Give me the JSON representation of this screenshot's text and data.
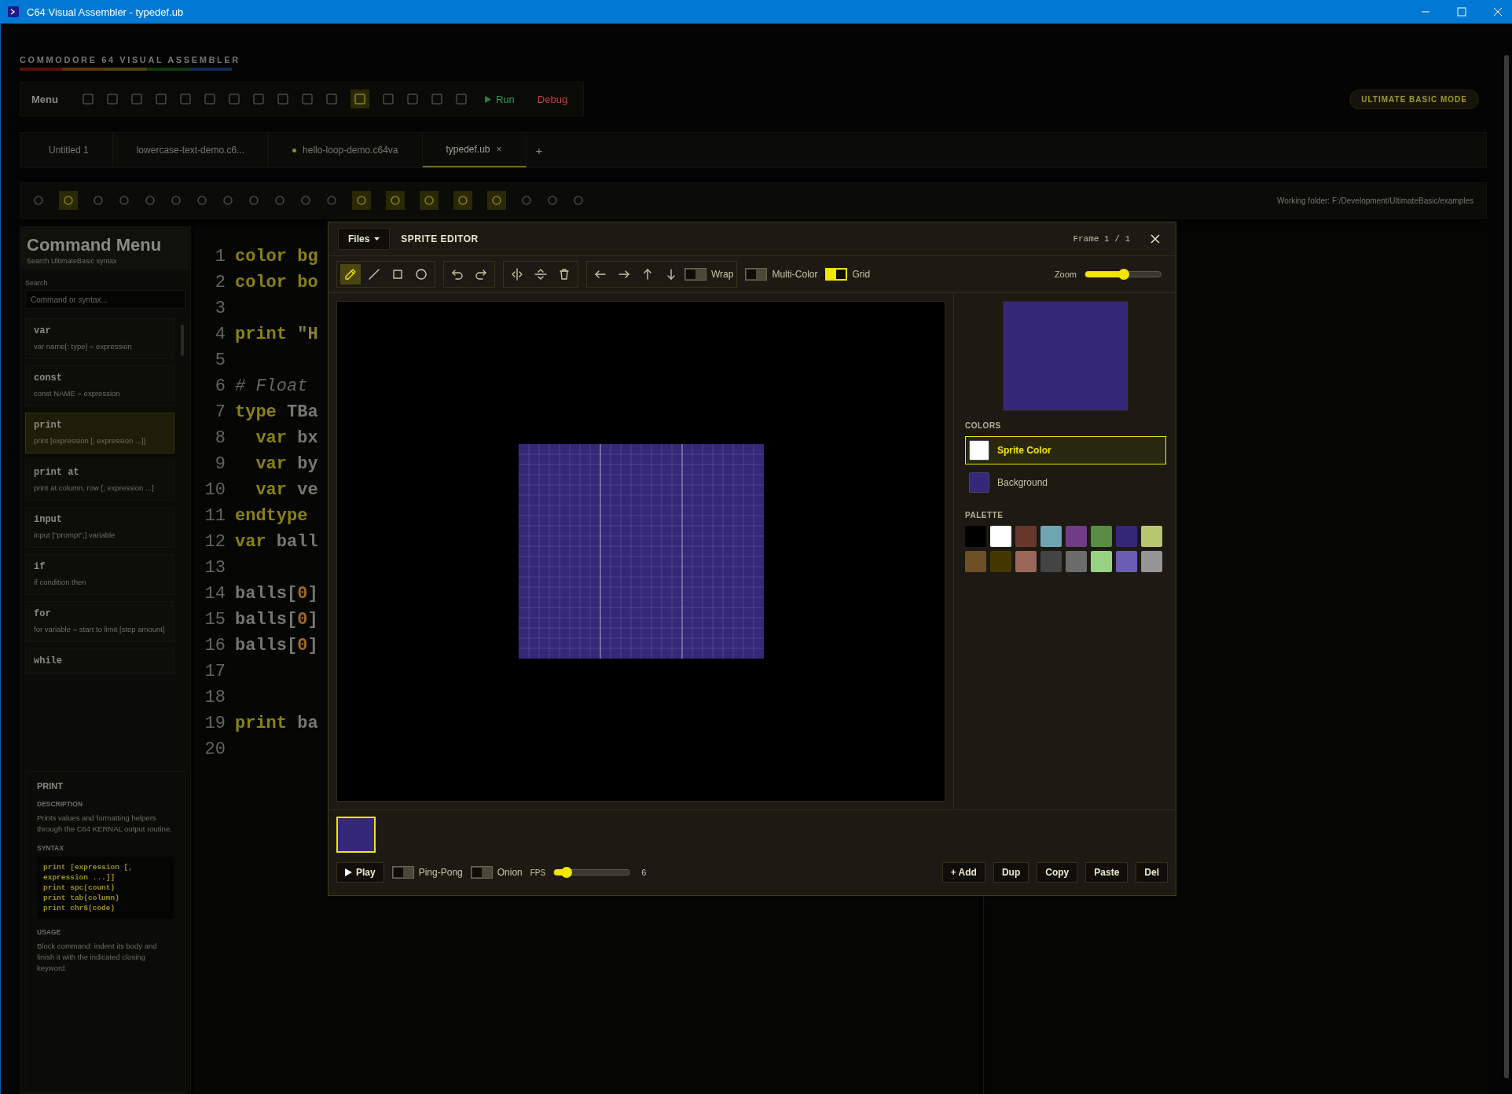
{
  "window": {
    "title": "C64 Visual Assembler - typedef.ub"
  },
  "app": {
    "logo": "COMMODORE 64 VISUAL ASSEMBLER",
    "mode_badge": "ULTIMATE BASIC MODE"
  },
  "toolbar": {
    "menu": "Menu",
    "run": "Run",
    "debug": "Debug"
  },
  "file_tabs": [
    {
      "label": "Untitled 1",
      "selected": false,
      "modified": false
    },
    {
      "label": "lowercase-text-demo.c6...",
      "selected": false,
      "modified": false
    },
    {
      "label": "hello-loop-demo.c64va",
      "selected": false,
      "modified": true
    },
    {
      "label": "typedef.ub",
      "selected": true,
      "modified": false,
      "close": "×"
    }
  ],
  "new_tab": "+",
  "working_folder": "Working folder: F:/Development/UltimateBasic/examples",
  "command_menu": {
    "title": "Command Menu",
    "subtitle": "Search UltimateBasic syntax",
    "search_label": "Search",
    "placeholder": "Command or syntax...",
    "items": [
      {
        "name": "var",
        "syntax": "var name[: type] = expression",
        "selected": false
      },
      {
        "name": "const",
        "syntax": "const NAME = expression",
        "selected": false
      },
      {
        "name": "print",
        "syntax": "print [expression [, expression ...]]",
        "selected": true
      },
      {
        "name": "print at",
        "syntax": "print at column, row [, expression ...]",
        "selected": false
      },
      {
        "name": "input",
        "syntax": "input [\"prompt\",] variable",
        "selected": false
      },
      {
        "name": "if",
        "syntax": "if condition then",
        "selected": false
      },
      {
        "name": "for",
        "syntax": "for variable = start to limit [step amount]",
        "selected": false
      },
      {
        "name": "while",
        "selected": false
      }
    ],
    "help": {
      "title": "PRINT",
      "description_heading": "DESCRIPTION",
      "description": "Prints values and formatting helpers through the C64 KERNAL output routine.",
      "syntax_heading": "SYNTAX",
      "syntax_lines": [
        "print [expression [,",
        "expression ...]]",
        "print spc(count)",
        "print tab(column)",
        "print chr$(code)"
      ],
      "usage_heading": "USAGE",
      "usage": "Block command: indent its body and finish it with the indicated closing keyword."
    }
  },
  "code_lines": [
    {
      "number": "1",
      "parts": [
        {
          "text": "color bg",
          "kind": "kw"
        }
      ]
    },
    {
      "number": "2",
      "parts": [
        {
          "text": "color bo",
          "kind": "kw"
        }
      ]
    },
    {
      "number": "3"
    },
    {
      "number": "4",
      "parts": [
        {
          "text": "print ",
          "kind": "kw"
        },
        {
          "text": "\"H",
          "kind": "str"
        }
      ]
    },
    {
      "number": "5"
    },
    {
      "number": "6",
      "parts": [
        {
          "text": "# Float",
          "kind": "comment"
        }
      ]
    },
    {
      "number": "7",
      "parts": [
        {
          "text": "type ",
          "kind": "kw"
        },
        {
          "text": "TBa",
          "kind": "id"
        }
      ]
    },
    {
      "number": "8",
      "parts": [
        {
          "text": "  var ",
          "kind": "kw"
        },
        {
          "text": "bx",
          "kind": "id"
        }
      ]
    },
    {
      "number": "9",
      "parts": [
        {
          "text": "  var ",
          "kind": "kw"
        },
        {
          "text": "by",
          "kind": "id"
        }
      ]
    },
    {
      "number": "10",
      "parts": [
        {
          "text": "  var ",
          "kind": "kw"
        },
        {
          "text": "ve",
          "kind": "id"
        }
      ]
    },
    {
      "number": "11",
      "parts": [
        {
          "text": "endtype",
          "kind": "kw"
        }
      ]
    },
    {
      "number": "12",
      "parts": [
        {
          "text": "var ",
          "kind": "kw"
        },
        {
          "text": "ball",
          "kind": "id"
        }
      ]
    },
    {
      "number": "13"
    },
    {
      "number": "14",
      "parts": [
        {
          "text": "balls[",
          "kind": "id"
        },
        {
          "text": "0",
          "kind": "num"
        },
        {
          "text": "]",
          "kind": "id"
        }
      ]
    },
    {
      "number": "15",
      "parts": [
        {
          "text": "balls[",
          "kind": "id"
        },
        {
          "text": "0",
          "kind": "num"
        },
        {
          "text": "]",
          "kind": "id"
        }
      ]
    },
    {
      "number": "16",
      "parts": [
        {
          "text": "balls[",
          "kind": "id"
        },
        {
          "text": "0",
          "kind": "num"
        },
        {
          "text": "]",
          "kind": "id"
        }
      ]
    },
    {
      "number": "17"
    },
    {
      "number": "18"
    },
    {
      "number": "19",
      "parts": [
        {
          "text": "print ",
          "kind": "kw"
        },
        {
          "text": "ba",
          "kind": "id"
        }
      ]
    },
    {
      "number": "20"
    }
  ],
  "sprite_editor": {
    "files_menu": "Files",
    "title": "SPRITE EDITOR",
    "frame_counter": "Frame 1 / 1",
    "tool_groups": [
      {
        "tools": [
          {
            "kind": "pencil",
            "selected": true
          },
          {
            "kind": "line",
            "selected": false
          },
          {
            "kind": "rect",
            "selected": false
          },
          {
            "kind": "circle",
            "selected": false
          }
        ]
      },
      {
        "tools": [
          {
            "kind": "undo",
            "selected": false
          },
          {
            "kind": "redo",
            "selected": false
          }
        ]
      },
      {
        "tools": [
          {
            "kind": "flip-h",
            "selected": false
          },
          {
            "kind": "flip-v",
            "selected": false
          },
          {
            "kind": "trash",
            "selected": false
          }
        ]
      },
      {
        "tools": [
          {
            "kind": "left",
            "selected": false
          },
          {
            "kind": "right",
            "selected": false
          },
          {
            "kind": "up",
            "selected": false
          },
          {
            "kind": "down",
            "selected": false
          }
        ],
        "toggle": {
          "label": "Wrap",
          "on": false
        }
      }
    ],
    "toggles": [
      {
        "label": "Multi-Color",
        "on": false
      },
      {
        "label": "Grid",
        "on": true
      }
    ],
    "zoom": {
      "label": "Zoom",
      "level": 0.5
    },
    "colors_heading": "COLORS",
    "colors": [
      {
        "label": "Sprite Color",
        "color": "#ffffff",
        "selected": true
      },
      {
        "label": "Background",
        "color": "#352879",
        "selected": false
      }
    ],
    "palette_heading": "PALETTE",
    "palette": [
      {
        "color": "#000000",
        "selected": false
      },
      {
        "color": "#ffffff",
        "selected": false
      },
      {
        "color": "#68372b",
        "selected": false
      },
      {
        "color": "#70a4b2",
        "selected": false
      },
      {
        "color": "#6f3d86",
        "selected": false
      },
      {
        "color": "#588d43",
        "selected": false
      },
      {
        "color": "#352879",
        "selected": false
      },
      {
        "color": "#b8c76f",
        "selected": false
      },
      {
        "color": "#6f4f25",
        "selected": false
      },
      {
        "color": "#433900",
        "selected": false
      },
      {
        "color": "#9a6759",
        "selected": false
      },
      {
        "color": "#444444",
        "selected": false
      },
      {
        "color": "#6c6c6c",
        "selected": false
      },
      {
        "color": "#9ad284",
        "selected": false
      },
      {
        "color": "#6c5eb5",
        "selected": false
      },
      {
        "color": "#959595",
        "selected": false
      }
    ],
    "frames": [
      {
        "selected": true
      }
    ],
    "play": "Play",
    "playback_toggles": [
      {
        "label": "Ping-Pong",
        "on": false
      },
      {
        "label": "Onion",
        "on": false
      }
    ],
    "fps": {
      "label": "FPS",
      "level": 0.15,
      "value": "6"
    },
    "frame_buttons": [
      "+ Add",
      "Dup",
      "Copy",
      "Paste",
      "Del"
    ]
  }
}
